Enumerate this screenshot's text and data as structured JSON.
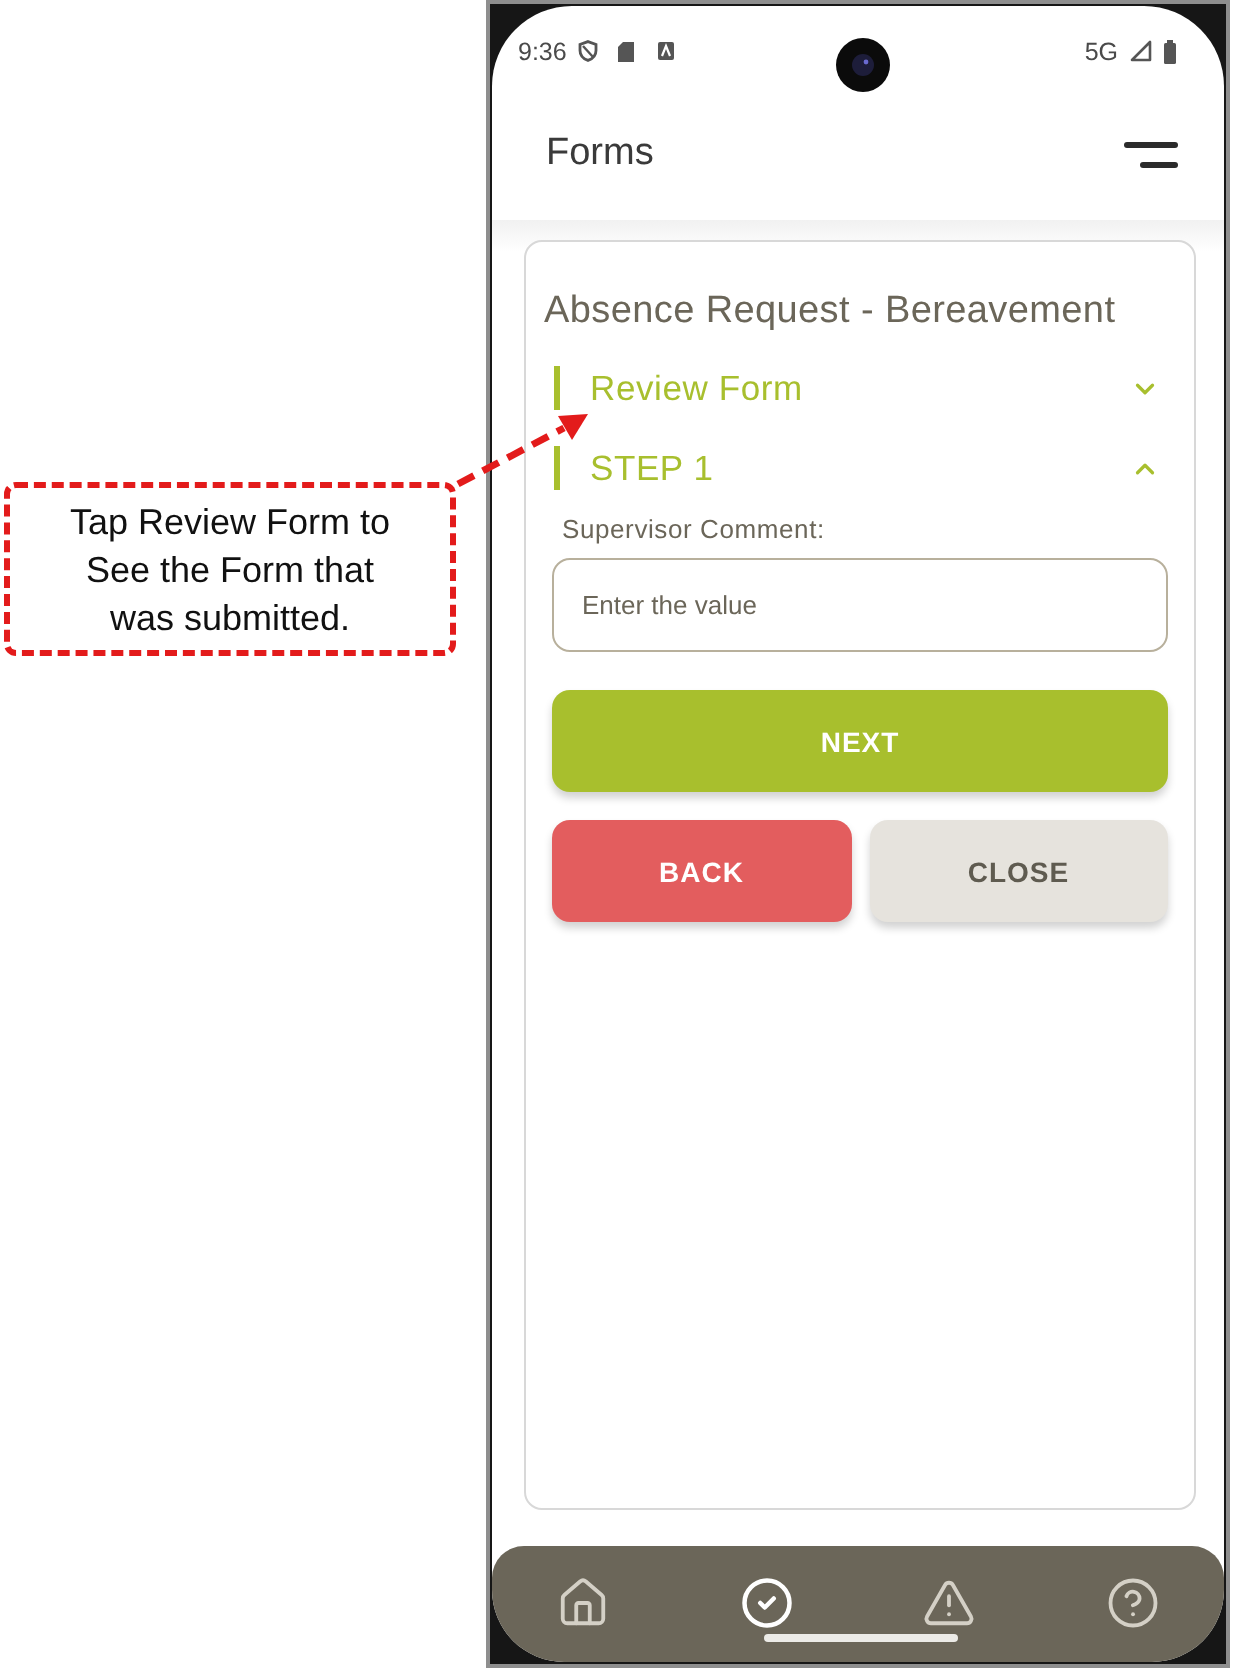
{
  "annotation": {
    "text": "Tap Review Form to See the Form that was submitted."
  },
  "status_bar": {
    "time": "9:36",
    "network": "5G"
  },
  "header": {
    "title": "Forms"
  },
  "form": {
    "title": "Absence Request - Bereavement",
    "sections": [
      {
        "label": "Review Form",
        "expanded": false
      },
      {
        "label": "STEP 1",
        "expanded": true
      }
    ],
    "field": {
      "label": "Supervisor Comment:",
      "placeholder": "Enter the value"
    },
    "buttons": [
      {
        "label": "NEXT",
        "kind": "primary"
      },
      {
        "label": "BACK",
        "kind": "danger"
      },
      {
        "label": "CLOSE",
        "kind": "neutral"
      }
    ]
  },
  "bottom_nav": [
    {
      "selected": false
    },
    {
      "selected": true
    },
    {
      "selected": false
    },
    {
      "selected": false
    }
  ]
}
